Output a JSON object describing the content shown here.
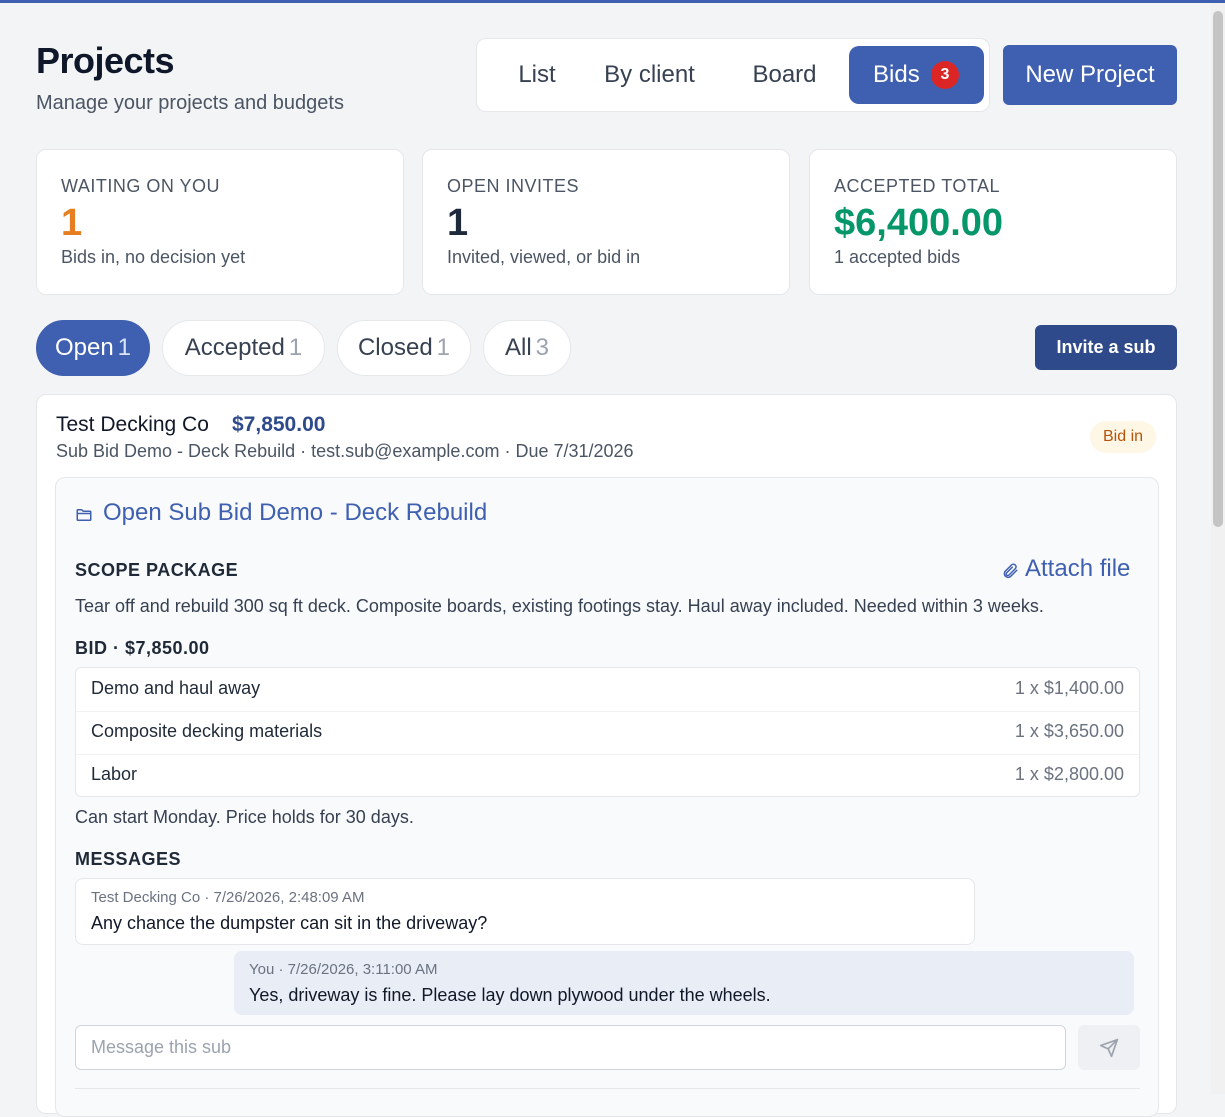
{
  "header": {
    "title": "Projects",
    "subtitle": "Manage your projects and budgets",
    "views": [
      "List",
      "By client",
      "Board",
      "Bids"
    ],
    "bids_badge": "3",
    "new_project": "New Project"
  },
  "stats": [
    {
      "label": "WAITING ON YOU",
      "value": "1",
      "desc": "Bids in, no decision yet",
      "color": "#e67e22"
    },
    {
      "label": "OPEN INVITES",
      "value": "1",
      "desc": "Invited, viewed, or bid in",
      "color": "#1e293b"
    },
    {
      "label": "ACCEPTED TOTAL",
      "value": "$6,400.00",
      "desc": "1 accepted bids",
      "color": "#059669"
    }
  ],
  "filters": [
    {
      "label": "Open",
      "count": "1"
    },
    {
      "label": "Accepted",
      "count": "1"
    },
    {
      "label": "Closed",
      "count": "1"
    },
    {
      "label": "All",
      "count": "3"
    }
  ],
  "invite_button": "Invite a sub",
  "bid": {
    "sub_name": "Test Decking Co",
    "amount": "$7,850.00",
    "meta": "Sub Bid Demo - Deck Rebuild · test.sub@example.com · Due 7/31/2026",
    "status": "Bid in",
    "open_link": "Open Sub Bid Demo - Deck Rebuild",
    "scope_heading": "SCOPE PACKAGE",
    "attach_label": "Attach file",
    "scope_text": "Tear off and rebuild 300 sq ft deck. Composite boards, existing footings stay. Haul away included. Needed within 3 weeks.",
    "bid_heading": "BID · $7,850.00",
    "line_items": [
      {
        "name": "Demo and haul away",
        "price": "1 x $1,400.00"
      },
      {
        "name": "Composite decking materials",
        "price": "1 x $3,650.00"
      },
      {
        "name": "Labor",
        "price": "1 x $2,800.00"
      }
    ],
    "note": "Can start Monday. Price holds for 30 days.",
    "messages_heading": "MESSAGES",
    "messages": [
      {
        "meta": "Test Decking Co · 7/26/2026, 2:48:09 AM",
        "body": "Any chance the dumpster can sit in the driveway?"
      },
      {
        "meta": "You · 7/26/2026, 3:11:00 AM",
        "body": "Yes, driveway is fine. Please lay down plywood under the wheels."
      }
    ],
    "message_placeholder": "Message this sub"
  },
  "icons": {
    "folder": "folder-icon",
    "attach": "paperclip-icon",
    "send": "send-icon"
  },
  "colors": {
    "accent": "#3f5fb0",
    "badge": "#dc2626",
    "status_bg": "#fef7e6",
    "status_text": "#b45309"
  }
}
